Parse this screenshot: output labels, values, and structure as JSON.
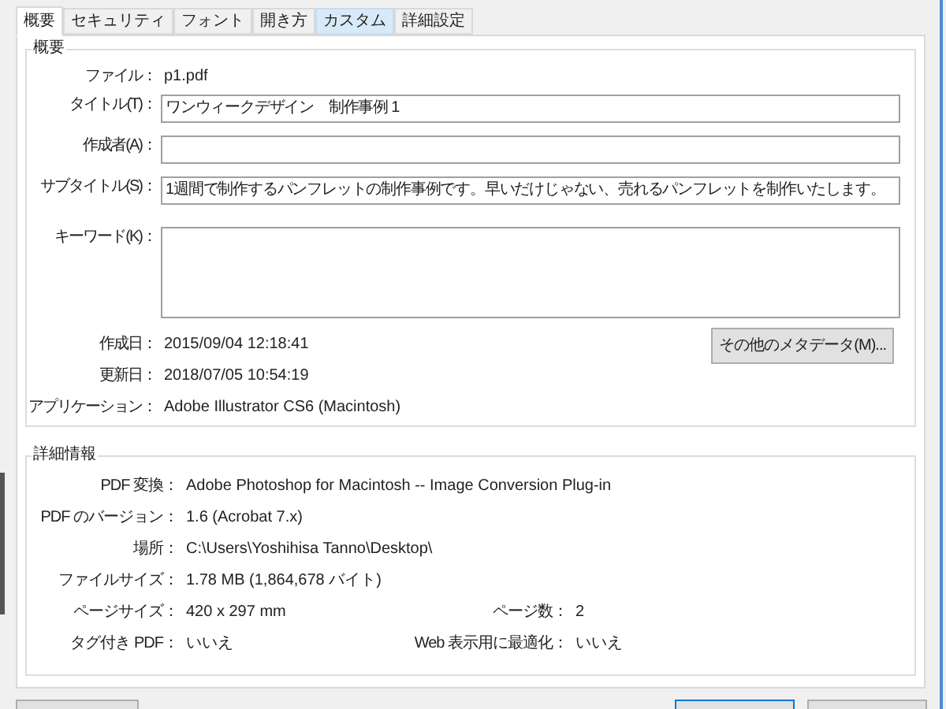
{
  "tabs": [
    {
      "label": "概要",
      "selected": true,
      "hovered": false
    },
    {
      "label": "セキュリティ",
      "selected": false,
      "hovered": false
    },
    {
      "label": "フォント",
      "selected": false,
      "hovered": false
    },
    {
      "label": "開き方",
      "selected": false,
      "hovered": false
    },
    {
      "label": "カスタム",
      "selected": false,
      "hovered": true
    },
    {
      "label": "詳細設定",
      "selected": false,
      "hovered": false
    }
  ],
  "summary": {
    "title": "概要",
    "file": {
      "label": "ファイル：",
      "value": "p1.pdf"
    },
    "fields": [
      {
        "label": "タイトル(T)：",
        "value": "ワンウィークデザイン　制作事例 1",
        "kind": "line"
      },
      {
        "label": "作成者(A)：",
        "kind": "line"
      },
      {
        "label": "サブタイトル(S)：",
        "value": "1週間で制作するパンフレットの制作事例です。早いだけじゃない、売れるパンフレットを制作いたします。",
        "kind": "line"
      },
      {
        "label": "キーワード(K)：",
        "kind": "area"
      }
    ],
    "dates": [
      {
        "label": "作成日：",
        "value": "2015/09/04 12:18:41"
      },
      {
        "label": "更新日：",
        "value": "2018/07/05 10:54:19"
      }
    ],
    "application": {
      "label": "アプリケーション：",
      "value": "Adobe Illustrator CS6 (Macintosh)"
    },
    "metadata_button": "その他のメタデータ(M)..."
  },
  "details": {
    "title": "詳細情報",
    "rows": [
      {
        "label": "PDF 変換：",
        "value": "Adobe Photoshop for Macintosh -- Image Conversion Plug-in"
      },
      {
        "label": "PDF のバージョン：",
        "value": "1.6 (Acrobat 7.x)"
      },
      {
        "label": "場所：",
        "value": "C:\\Users\\Yoshihisa Tanno\\Desktop\\"
      },
      {
        "label": "ファイルサイズ：",
        "value": "1.78 MB (1,864,678 バイト)"
      },
      {
        "label": "ページサイズ：",
        "value": "420 x 297 mm",
        "label_2": "ページ数：",
        "value_2": "2"
      },
      {
        "label": "タグ付き PDF：",
        "value": "いいえ",
        "label_2": "Web 表示用に最適化：",
        "value_2": "いいえ"
      }
    ]
  }
}
